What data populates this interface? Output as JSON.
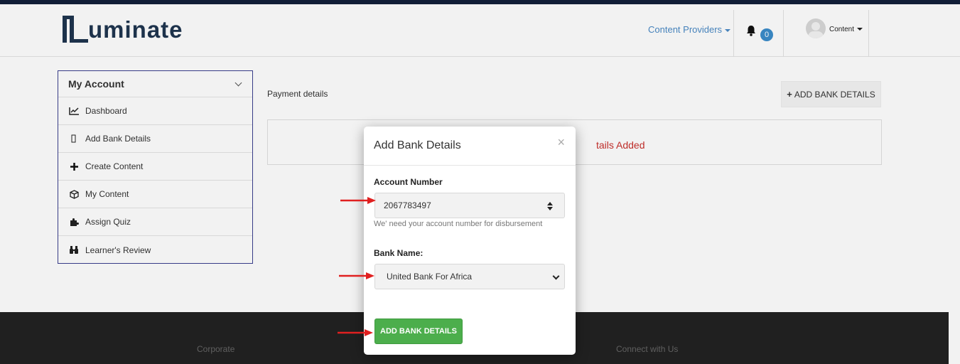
{
  "header": {
    "logo_text": "uminate",
    "nav_providers": "Content Providers",
    "notification_count": "0",
    "user_label": "Content"
  },
  "sidebar": {
    "title": "My Account",
    "items": [
      {
        "label": "Dashboard",
        "icon": "line-chart-icon"
      },
      {
        "label": "Add Bank Details",
        "icon": "bank-card-icon"
      },
      {
        "label": "Create Content",
        "icon": "plus-icon"
      },
      {
        "label": "My Content",
        "icon": "cube-icon"
      },
      {
        "label": "Assign Quiz",
        "icon": "puzzle-icon"
      },
      {
        "label": "Learner's Review",
        "icon": "binoculars-icon"
      }
    ]
  },
  "main": {
    "section_label": "Payment details",
    "add_button_label": "ADD BANK DETAILS",
    "info_message": "tails Added"
  },
  "modal": {
    "title": "Add Bank Details",
    "close_symbol": "×",
    "account_number_label": "Account Number",
    "account_number_value": "2067783497",
    "account_help": "We' need your account number for disbursement",
    "bank_name_label": "Bank Name:",
    "bank_name_value": "United Bank For Africa",
    "submit_label": "ADD BANK DETAILS"
  },
  "footer": {
    "left_heading": "Corporate",
    "right_heading": "Connect with Us"
  },
  "colors": {
    "brand_dark": "#1f3550",
    "link_blue": "#4a8ac6",
    "success_green": "#4cae4c",
    "error_red": "#c9302c",
    "annotation_red": "#e02020"
  }
}
